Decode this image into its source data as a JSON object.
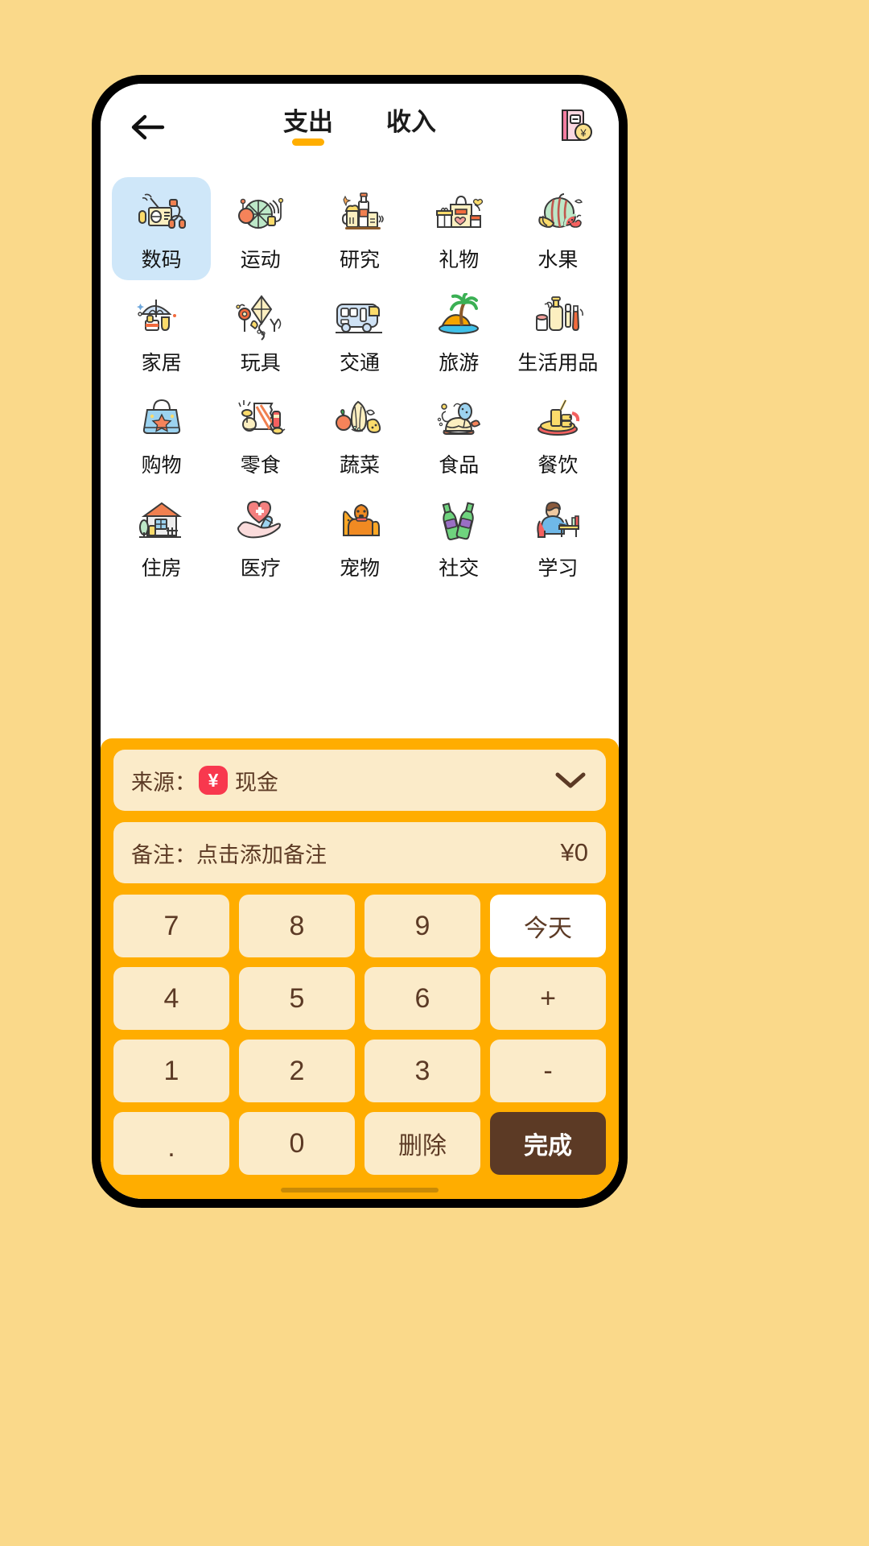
{
  "theme": {
    "page_bg": "#FAD98A",
    "panel_orange": "#FFAD00",
    "key_cream": "#FBEBC9",
    "brown": "#5C3A25",
    "accent_underline": "#FFAE00",
    "selected_chip": "#CFE7F9",
    "yen_badge_red": "#F8384E"
  },
  "header": {
    "back_icon": "arrow-left-icon",
    "ledger_icon": "ledger-book-yen-icon",
    "tabs": [
      {
        "label": "支出",
        "active": true
      },
      {
        "label": "收入",
        "active": false
      }
    ]
  },
  "categories": {
    "selected_index": 0,
    "rows": [
      [
        {
          "label": "数码",
          "icon": "radio-digital-icon",
          "selected": true
        },
        {
          "label": "运动",
          "icon": "ball-sports-icon",
          "selected": false
        },
        {
          "label": "研究",
          "icon": "bottles-research-icon",
          "selected": false
        },
        {
          "label": "礼物",
          "icon": "gift-bag-icon",
          "selected": false
        },
        {
          "label": "水果",
          "icon": "watermelon-fruit-icon",
          "selected": false
        }
      ],
      [
        {
          "label": "家居",
          "icon": "umbrella-boots-icon",
          "selected": false
        },
        {
          "label": "玩具",
          "icon": "kite-toy-icon",
          "selected": false
        },
        {
          "label": "交通",
          "icon": "bus-transport-icon",
          "selected": false
        },
        {
          "label": "旅游",
          "icon": "palm-island-icon",
          "selected": false
        },
        {
          "label": "生活用品",
          "icon": "toiletries-icon",
          "selected": false
        }
      ],
      [
        {
          "label": "购物",
          "icon": "shopping-bag-icon",
          "selected": false
        },
        {
          "label": "零食",
          "icon": "snack-pack-icon",
          "selected": false
        },
        {
          "label": "蔬菜",
          "icon": "vegetables-icon",
          "selected": false
        },
        {
          "label": "食品",
          "icon": "cake-balloon-food-icon",
          "selected": false
        },
        {
          "label": "餐饮",
          "icon": "drink-meal-icon",
          "selected": false
        }
      ],
      [
        {
          "label": "住房",
          "icon": "house-home-icon",
          "selected": false
        },
        {
          "label": "医疗",
          "icon": "heart-pill-hand-icon",
          "selected": false
        },
        {
          "label": "宠物",
          "icon": "dog-cat-pet-icon",
          "selected": false
        },
        {
          "label": "社交",
          "icon": "beer-bottles-social-icon",
          "selected": false
        },
        {
          "label": "学习",
          "icon": "student-desk-study-icon",
          "selected": false
        }
      ]
    ]
  },
  "form": {
    "source": {
      "label": "来源：",
      "badge_symbol": "¥",
      "value": "现金",
      "chevron_icon": "chevron-down-icon"
    },
    "note": {
      "label": "备注：",
      "placeholder": "点击添加备注",
      "amount": "¥0"
    }
  },
  "keypad": {
    "keys": [
      {
        "label": "7",
        "type": "digit"
      },
      {
        "label": "8",
        "type": "digit"
      },
      {
        "label": "9",
        "type": "digit"
      },
      {
        "label": "今天",
        "type": "today"
      },
      {
        "label": "4",
        "type": "digit"
      },
      {
        "label": "5",
        "type": "digit"
      },
      {
        "label": "6",
        "type": "digit"
      },
      {
        "label": "+",
        "type": "op"
      },
      {
        "label": "1",
        "type": "digit"
      },
      {
        "label": "2",
        "type": "digit"
      },
      {
        "label": "3",
        "type": "digit"
      },
      {
        "label": "-",
        "type": "op"
      },
      {
        "label": ".",
        "type": "dot"
      },
      {
        "label": "0",
        "type": "digit"
      },
      {
        "label": "删除",
        "type": "cn"
      },
      {
        "label": "完成",
        "type": "done"
      }
    ]
  }
}
